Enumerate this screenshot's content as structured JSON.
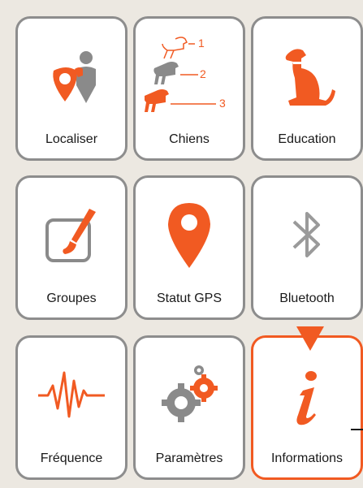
{
  "colors": {
    "accent": "#f15a22",
    "icon_gray": "#8a8a8a",
    "border_gray": "#8d8d8d",
    "background": "#ece8e1"
  },
  "tiles": [
    {
      "label": "Localiser",
      "icon": "locate-dog-pin-icon"
    },
    {
      "label": "Chiens",
      "icon": "dogs-list-icon",
      "numbers": [
        "1",
        "2",
        "3"
      ]
    },
    {
      "label": "Education",
      "icon": "sitting-dog-icon"
    },
    {
      "label": "Groupes",
      "icon": "paintbrush-icon"
    },
    {
      "label": "Statut GPS",
      "icon": "gps-pin-icon"
    },
    {
      "label": "Bluetooth",
      "icon": "bluetooth-icon"
    },
    {
      "label": "Fréquence",
      "icon": "frequency-wave-icon"
    },
    {
      "label": "Paramètres",
      "icon": "gears-icon"
    },
    {
      "label": "Informations",
      "icon": "info-icon",
      "selected": true
    }
  ]
}
